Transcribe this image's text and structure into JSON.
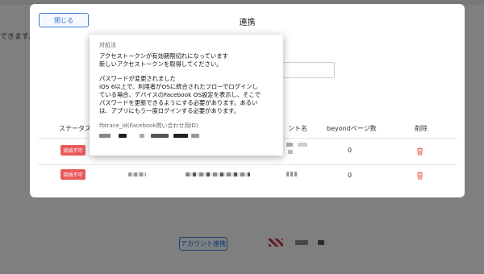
{
  "background": {
    "partial_text": "できます。",
    "account_link_button": "アカウント連携"
  },
  "modal": {
    "title": "連携",
    "close_label": "閉じる",
    "table": {
      "headers": {
        "status": "ステータス",
        "account_name": "ント名",
        "page_count": "beyondページ数",
        "delete": "削除"
      },
      "rows": [
        {
          "status": "接続不可",
          "page_count": "0"
        },
        {
          "status": "接続不可",
          "page_count": "0"
        }
      ]
    }
  },
  "tooltip": {
    "title": "対処法",
    "lines_1": [
      "アクセストークンが有効期限切れになっています",
      "新しいアクセストークンを取得してください。"
    ],
    "lines_2": [
      "パスワードが変更されました",
      "iOS 6以上で、利用者がOSに統合されたフローでログインし",
      "ている場合、デバイスのFacebook OS設定を表示し、そこで",
      "パスワードを更新できるようにする必要があります。あるい",
      "は、アプリにもう一度ログインする必要があります。"
    ],
    "trace_label": "fbtrace_id(Facebook問い合わせ用ID)"
  },
  "colors": {
    "accent": "#3e7bd6",
    "danger": "#e85a5a",
    "overlay": "rgba(0,0,0,0.48)"
  },
  "icons": [
    "trash-icon"
  ]
}
